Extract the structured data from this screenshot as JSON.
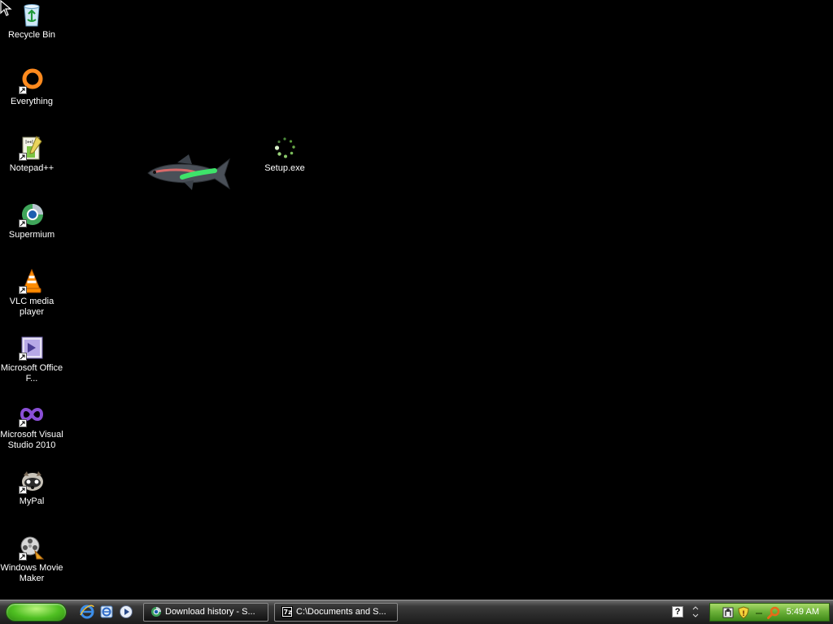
{
  "desktop": {
    "icons": [
      {
        "label": "Recycle Bin",
        "icon": "recycle-bin-icon",
        "shortcut": false
      },
      {
        "label": "Everything",
        "icon": "everything-icon",
        "shortcut": true
      },
      {
        "label": "Notepad++",
        "icon": "notepad-plus-plus-icon",
        "shortcut": true
      },
      {
        "label": "Supermium",
        "icon": "supermium-icon",
        "shortcut": true
      },
      {
        "label": "VLC media player",
        "icon": "vlc-icon",
        "shortcut": true
      },
      {
        "label": "Microsoft Office F...",
        "icon": "office-icon",
        "shortcut": true
      },
      {
        "label": "Microsoft Visual Studio 2010",
        "icon": "visual-studio-icon",
        "shortcut": true
      },
      {
        "label": "MyPal",
        "icon": "mypal-icon",
        "shortcut": true
      },
      {
        "label": "Windows Movie Maker",
        "icon": "movie-maker-icon",
        "shortcut": true
      },
      {
        "label": "Setup.exe",
        "icon": "setup-loading-icon",
        "shortcut": false
      }
    ],
    "wallpaper_color": "#000000"
  },
  "taskbar": {
    "quick_launch": [
      "internet-explorer-icon",
      "ie-alt-icon",
      "media-player-icon"
    ],
    "tasks": [
      {
        "label": "Download history - S...",
        "icon": "browser-icon"
      },
      {
        "label": "C:\\Documents and S...",
        "icon": "seven-zip-icon"
      }
    ],
    "tray_icons": [
      "network-icon",
      "security-shield-icon",
      "search-icon"
    ],
    "clock": "5:49 AM",
    "help_glyph": "?",
    "colors": {
      "start": "#4fbf22",
      "tray": "#6fb33b"
    }
  }
}
